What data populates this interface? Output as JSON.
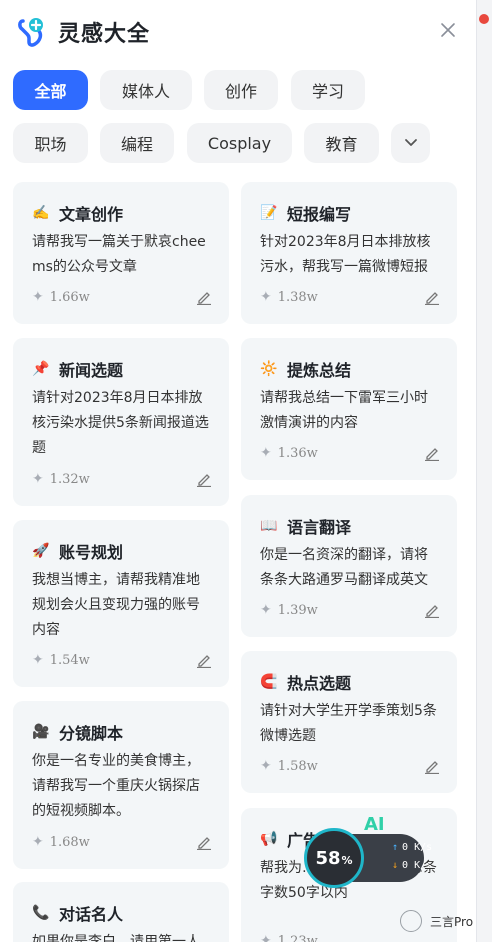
{
  "header": {
    "title": "灵感大全"
  },
  "categories": [
    "全部",
    "媒体人",
    "创作",
    "学习",
    "职场",
    "编程",
    "Cosplay",
    "教育"
  ],
  "cards": [
    {
      "icon": "writing-hand-icon",
      "emoji": "✍️",
      "title": "文章创作",
      "desc": "请帮我写一篇关于默哀cheems的公众号文章",
      "uses": "1.66w"
    },
    {
      "icon": "memo-icon",
      "emoji": "📝",
      "title": "短报编写",
      "desc": "针对2023年8月日本排放核污水，帮我写一篇微博短报",
      "uses": "1.38w"
    },
    {
      "icon": "pushpin-icon",
      "emoji": "📌",
      "title": "新闻选题",
      "desc": "请针对2023年8月日本排放核污染水提供5条新闻报道选题",
      "uses": "1.32w"
    },
    {
      "icon": "sun-icon",
      "emoji": "🔆",
      "title": "提炼总结",
      "desc": "请帮我总结一下雷军三小时激情演讲的内容",
      "uses": "1.36w"
    },
    {
      "icon": "rocket-icon",
      "emoji": "🚀",
      "title": "账号规划",
      "desc": "我想当博主，请帮我精准地规划会火且变现力强的账号内容",
      "uses": "1.54w"
    },
    {
      "icon": "open-book-icon",
      "emoji": "📖",
      "title": "语言翻译",
      "desc": "你是一名资深的翻译，请将条条大路通罗马翻译成英文",
      "uses": "1.39w"
    },
    {
      "icon": "magnet-icon",
      "emoji": "🧲",
      "title": "热点选题",
      "desc": "请针对大学生开学季策划5条微博选题",
      "uses": "1.58w"
    },
    {
      "icon": "film-camera-icon",
      "emoji": "🎥",
      "title": "分镜脚本",
      "desc": "你是一名专业的美食博主，请帮我写一个重庆火锅探店的短视频脚本。",
      "uses": "1.68w"
    },
    {
      "icon": "megaphone-icon",
      "emoji": "📢",
      "title": "广告",
      "desc": "帮我为…3个广告文案，每条字数50字以内",
      "uses": "1.23w"
    },
    {
      "icon": "telephone-icon",
      "emoji": "📞",
      "title": "对话名人",
      "desc": "如果你是李白，请用第一人",
      "uses": ""
    }
  ],
  "overlay": {
    "percent": "58",
    "percent_unit": "%",
    "up": "0 K/s",
    "down": "0 K/s",
    "ai": "AI",
    "brand": "三言Pro"
  }
}
